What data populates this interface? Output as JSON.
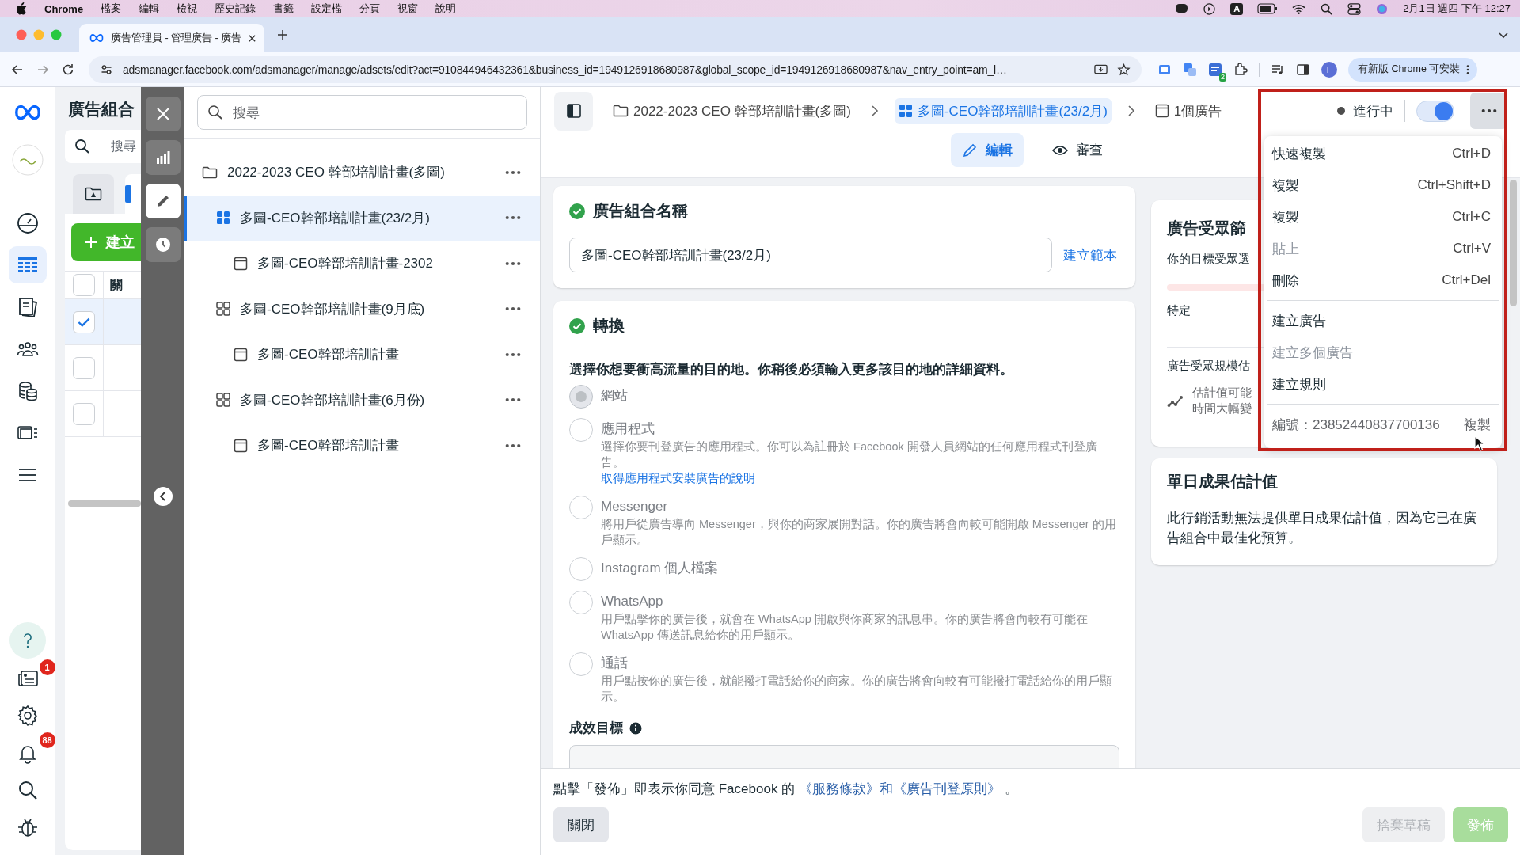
{
  "menubar": {
    "app": "Chrome",
    "menus": [
      "檔案",
      "編輯",
      "檢視",
      "歷史記錄",
      "書籤",
      "設定檔",
      "分頁",
      "視窗",
      "說明"
    ],
    "input_source": "A",
    "clock": "2月1日 週四 下午 12:27"
  },
  "browser": {
    "tab_title": "廣告管理員 - 管理廣告 - 廣告",
    "url": "adsmanager.facebook.com/adsmanager/manage/adsets/edit?act=910844946432361&business_id=1949126918680987&global_scope_id=1949126918680987&nav_entry_point=am_l…",
    "extension_badge": "2",
    "profile_initial": "F",
    "update_button": "有新版 Chrome 可安裝"
  },
  "nav_rail": {
    "items": [
      {
        "selected": false
      },
      {
        "selected": true
      },
      {
        "selected": false
      },
      {
        "selected": false
      },
      {
        "selected": false
      },
      {
        "selected": false
      },
      {
        "selected": false
      }
    ],
    "bottom_items": [
      {
        "kind": "help"
      },
      {
        "kind": "news",
        "badge": "1"
      },
      {
        "kind": "settings"
      },
      {
        "kind": "bell",
        "badge": "88"
      },
      {
        "kind": "search"
      },
      {
        "kind": "bug"
      }
    ]
  },
  "campaign_panel": {
    "title": "廣告組合",
    "search_placeholder": "搜尋",
    "create_button": "建立",
    "column_header": "關",
    "header_checked": false,
    "rows": [
      {
        "checked": true,
        "selected": true
      },
      {
        "checked": false,
        "selected": false
      },
      {
        "checked": false,
        "selected": false
      }
    ]
  },
  "toolbar": {
    "buttons": [
      {
        "selected": false
      },
      {
        "selected": false
      },
      {
        "selected": true
      },
      {
        "selected": false
      }
    ]
  },
  "tree": {
    "search_placeholder": "搜尋",
    "items": [
      {
        "label": "2022-2023 CEO 幹部培訓計畫(多圖)",
        "selected": false,
        "children": [
          {
            "label": "多圖-CEO幹部培訓計畫(23/2月)",
            "selected": true,
            "children": [
              {
                "label": "多圖-CEO幹部培訓計畫-2302",
                "selected": false
              }
            ]
          },
          {
            "label": "多圖-CEO幹部培訓計畫(9月底)",
            "selected": false,
            "children": [
              {
                "label": "多圖-CEO幹部培訓計畫",
                "selected": false
              }
            ]
          },
          {
            "label": "多圖-CEO幹部培訓計畫(6月份)",
            "selected": false,
            "children": [
              {
                "label": "多圖-CEO幹部培訓計畫",
                "selected": false
              }
            ]
          }
        ]
      }
    ]
  },
  "header": {
    "breadcrumbs": [
      {
        "kind": "campaign",
        "label": "2022-2023 CEO 幹部培訓計畫(多圖)",
        "selected": false
      },
      {
        "kind": "adset",
        "label": "多圖-CEO幹部培訓計畫(23/2月)",
        "selected": true
      },
      {
        "kind": "ad",
        "label": "1個廣告",
        "selected": false
      }
    ],
    "status": "進行中",
    "toggle_on": true,
    "menu_open": true,
    "tabs": [
      {
        "label": "編輯",
        "selected": true
      },
      {
        "label": "審查",
        "selected": false
      }
    ]
  },
  "name_card": {
    "title": "廣告組合名稱",
    "complete": true,
    "value": "多圖-CEO幹部培訓計畫(23/2月)",
    "link": "建立範本"
  },
  "conversion_card": {
    "title": "轉換",
    "complete": true,
    "question": "選擇你想要衝高流量的目的地。你稍後必須輸入更多該目的地的詳細資料。",
    "options": [
      {
        "label": "網站",
        "selected": true
      },
      {
        "label": "應用程式",
        "selected": false,
        "description": "選擇你要刊登廣告的應用程式。你可以為註冊於 Facebook 開發人員網站的任何應用程式刊登廣告。",
        "link": "取得應用程式安裝廣告的說明"
      },
      {
        "label": "Messenger",
        "selected": false,
        "description": "將用戶從廣告導向 Messenger，與你的商家展開對話。你的廣告將會向較可能開啟 Messenger 的用戶顯示。"
      },
      {
        "label": "Instagram 個人檔案",
        "selected": false
      },
      {
        "label": "WhatsApp",
        "selected": false,
        "description": "用戶點擊你的廣告後，就會在 WhatsApp 開啟與你商家的訊息串。你的廣告將會向較有可能在 WhatsApp 傳送訊息給你的用戶顯示。"
      },
      {
        "label": "通話",
        "selected": false,
        "description": "用戶點按你的廣告後，就能撥打電話給你的商家。你的廣告將會向較有可能撥打電話給你的用戶顯示。"
      }
    ],
    "goal_label": "成效目標"
  },
  "audience_card": {
    "title": "廣告受眾篩",
    "text": "你的目標受眾選",
    "label": "特定",
    "size_label": "廣告受眾規模估",
    "estimate_lines": [
      "估計值可能",
      "時間大幅變"
    ]
  },
  "daily_card": {
    "title": "單日成果估計值",
    "text": "此行銷活動無法提供單日成果估計值，因為它已在廣告組合中最佳化預算。"
  },
  "menu": {
    "sections": [
      [
        {
          "label": "快速複製",
          "shortcut": "Ctrl+D",
          "disabled": false
        },
        {
          "label": "複製",
          "shortcut": "Ctrl+Shift+D",
          "disabled": false
        },
        {
          "label": "複製",
          "shortcut": "Ctrl+C",
          "disabled": false
        },
        {
          "label": "貼上",
          "shortcut": "Ctrl+V",
          "disabled": true
        },
        {
          "label": "刪除",
          "shortcut": "Ctrl+Del",
          "disabled": false
        }
      ],
      [
        {
          "label": "建立廣告",
          "disabled": false
        },
        {
          "label": "建立多個廣告",
          "disabled": true
        },
        {
          "label": "建立規則",
          "disabled": false
        }
      ]
    ],
    "id_label": "編號：23852440837700136",
    "copy_link": "複製"
  },
  "footer": {
    "agreement_prefix": "點擊「發佈」即表示你同意 Facebook 的 ",
    "terms_link": "《服務條款》和《廣告刊登原則》",
    "agreement_suffix": " 。",
    "buttons": [
      {
        "kind": "secondary",
        "label": "關閉",
        "disabled": false
      },
      {
        "kind": "secondary",
        "label": "捨棄草稿",
        "disabled": true
      },
      {
        "kind": "primary",
        "label": "發佈",
        "disabled": true
      }
    ]
  }
}
